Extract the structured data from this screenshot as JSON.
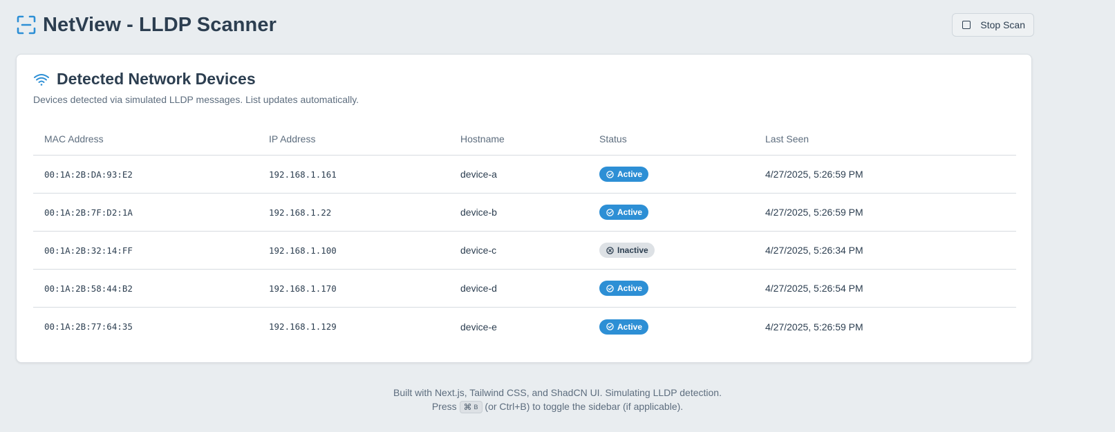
{
  "header": {
    "title": "NetView - LLDP Scanner",
    "stop_button_label": "Stop Scan"
  },
  "card": {
    "title": "Detected Network Devices",
    "description": "Devices detected via simulated LLDP messages. List updates automatically."
  },
  "table": {
    "columns": [
      "MAC Address",
      "IP Address",
      "Hostname",
      "Status",
      "Last Seen"
    ],
    "rows": [
      {
        "mac": "00:1A:2B:DA:93:E2",
        "ip": "192.168.1.161",
        "hostname": "device-a",
        "status": "Active",
        "last_seen": "4/27/2025, 5:26:59 PM"
      },
      {
        "mac": "00:1A:2B:7F:D2:1A",
        "ip": "192.168.1.22",
        "hostname": "device-b",
        "status": "Active",
        "last_seen": "4/27/2025, 5:26:59 PM"
      },
      {
        "mac": "00:1A:2B:32:14:FF",
        "ip": "192.168.1.100",
        "hostname": "device-c",
        "status": "Inactive",
        "last_seen": "4/27/2025, 5:26:34 PM"
      },
      {
        "mac": "00:1A:2B:58:44:B2",
        "ip": "192.168.1.170",
        "hostname": "device-d",
        "status": "Active",
        "last_seen": "4/27/2025, 5:26:54 PM"
      },
      {
        "mac": "00:1A:2B:77:64:35",
        "ip": "192.168.1.129",
        "hostname": "device-e",
        "status": "Active",
        "last_seen": "4/27/2025, 5:26:59 PM"
      }
    ]
  },
  "footer": {
    "line1": "Built with Next.js, Tailwind CSS, and ShadCN UI. Simulating LLDP detection.",
    "press": "Press",
    "kbd_symbol": "⌘",
    "kbd_key": "B",
    "line2_rest": "(or Ctrl+B) to toggle the sidebar (if applicable)."
  },
  "icons": {
    "brand": "scan-icon",
    "stop": "square-icon",
    "card": "wifi-icon",
    "active": "check-circle-icon",
    "inactive": "x-circle-icon"
  },
  "colors": {
    "accent": "#2d8fd5",
    "background": "#e9edf0",
    "text": "#2c3e50",
    "inactive_badge": "#dde1e5"
  }
}
